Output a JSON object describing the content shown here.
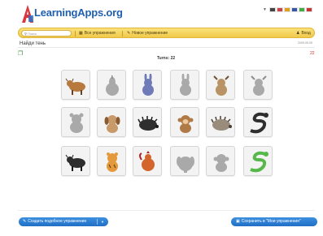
{
  "header": {
    "logo_text": "LearningApps.org",
    "flags": [
      {
        "name": "de",
        "color": "#444444"
      },
      {
        "name": "en",
        "color": "#cc4444"
      },
      {
        "name": "es",
        "color": "#e0a020"
      },
      {
        "name": "fr",
        "color": "#3355aa"
      },
      {
        "name": "it",
        "color": "#44aa44"
      },
      {
        "name": "ru",
        "color": "#cc3333"
      }
    ]
  },
  "nav": {
    "search_placeholder": "Поиск",
    "all_exercises": "Все упражнения",
    "new_exercise": "Новое упражнение",
    "login": "Вход"
  },
  "app": {
    "title": "Найди тень",
    "date": "2009-05-05",
    "score": "22",
    "turns": "Turns: 22"
  },
  "grid": [
    {
      "animal": "bull",
      "state": "color"
    },
    {
      "animal": "pear",
      "state": "shadow"
    },
    {
      "animal": "rabbit",
      "state": "color"
    },
    {
      "animal": "rabbit",
      "state": "shadow"
    },
    {
      "animal": "goat",
      "state": "color"
    },
    {
      "animal": "goat",
      "state": "shadow"
    },
    {
      "animal": "teddy-bear",
      "state": "shadow"
    },
    {
      "animal": "dog",
      "state": "color"
    },
    {
      "animal": "hedgehog",
      "state": "shadow"
    },
    {
      "animal": "monkey",
      "state": "color"
    },
    {
      "animal": "hedgehog",
      "state": "color"
    },
    {
      "animal": "snake",
      "state": "shadow"
    },
    {
      "animal": "bull",
      "state": "shadow"
    },
    {
      "animal": "tiger",
      "state": "color"
    },
    {
      "animal": "rooster",
      "state": "color"
    },
    {
      "animal": "elephant",
      "state": "shadow"
    },
    {
      "animal": "monkey",
      "state": "shadow"
    },
    {
      "animal": "snake",
      "state": "color"
    }
  ],
  "footer": {
    "create_similar": "Создать подобное упражнение",
    "save_my": "Сохранить в \"Мои упражнения\""
  },
  "colors": {
    "nav_yellow": "#f0c94a",
    "button_blue": "#1f6fc5",
    "logo_blue": "#1f5fb0",
    "score_red": "#d12a2a"
  }
}
